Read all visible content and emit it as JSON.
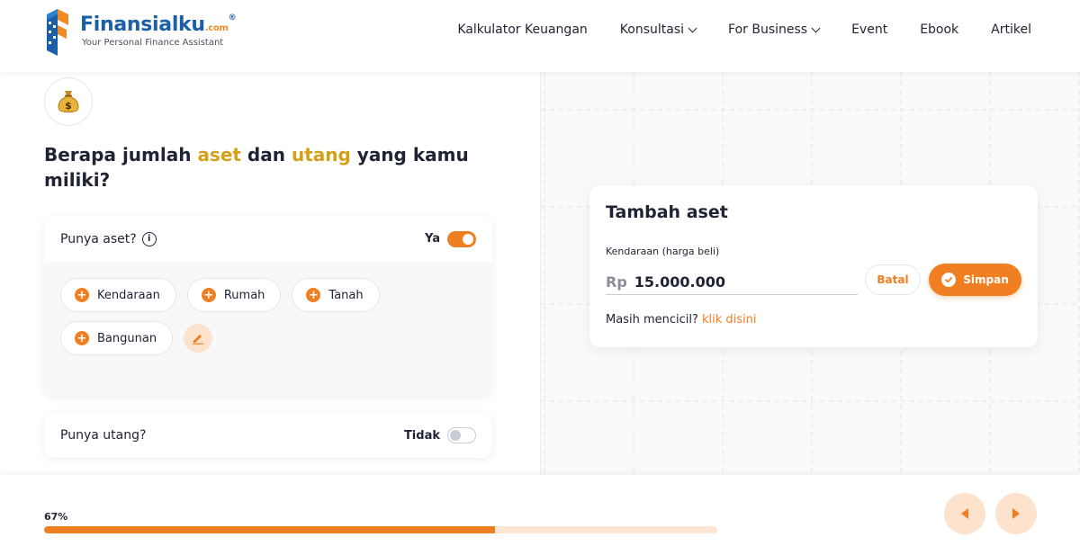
{
  "brand": {
    "name": "Finansialku",
    "dotcom": ".com",
    "reg": "®",
    "tagline": "Your Personal Finance Assistant"
  },
  "nav": {
    "items": [
      {
        "label": "Kalkulator Keuangan",
        "dropdown": false
      },
      {
        "label": "Konsultasi",
        "dropdown": true
      },
      {
        "label": "For Business",
        "dropdown": true
      },
      {
        "label": "Event",
        "dropdown": false
      },
      {
        "label": "Ebook",
        "dropdown": false
      },
      {
        "label": "Artikel",
        "dropdown": false
      }
    ]
  },
  "question": {
    "icon": "money-bag-icon",
    "part1": "Berapa jumlah ",
    "hl1": "aset",
    "part2": " dan ",
    "hl2": "utang",
    "part3": " yang kamu miliki?"
  },
  "aset_card": {
    "title": "Punya aset?",
    "info_glyph": "i",
    "toggle_label": "Ya",
    "toggle_on": true,
    "chips": [
      "Kendaraan",
      "Rumah",
      "Tanah",
      "Bangunan"
    ],
    "plus_glyph": "+"
  },
  "utang_card": {
    "title": "Punya utang?",
    "toggle_label": "Tidak",
    "toggle_on": false
  },
  "popup": {
    "title": "Tambah aset",
    "field_label": "Kendaraan (harga beli)",
    "currency": "Rp",
    "amount": "15.000.000",
    "cancel_label": "Batal",
    "save_label": "Simpan",
    "installment_text": "Masih mencicil? ",
    "installment_link": "klik disini"
  },
  "progress": {
    "label": "67%",
    "value": 0.67
  },
  "colors": {
    "accent": "#f07f21",
    "highlight": "#d4a017",
    "brand_blue": "#1b5fa8"
  }
}
